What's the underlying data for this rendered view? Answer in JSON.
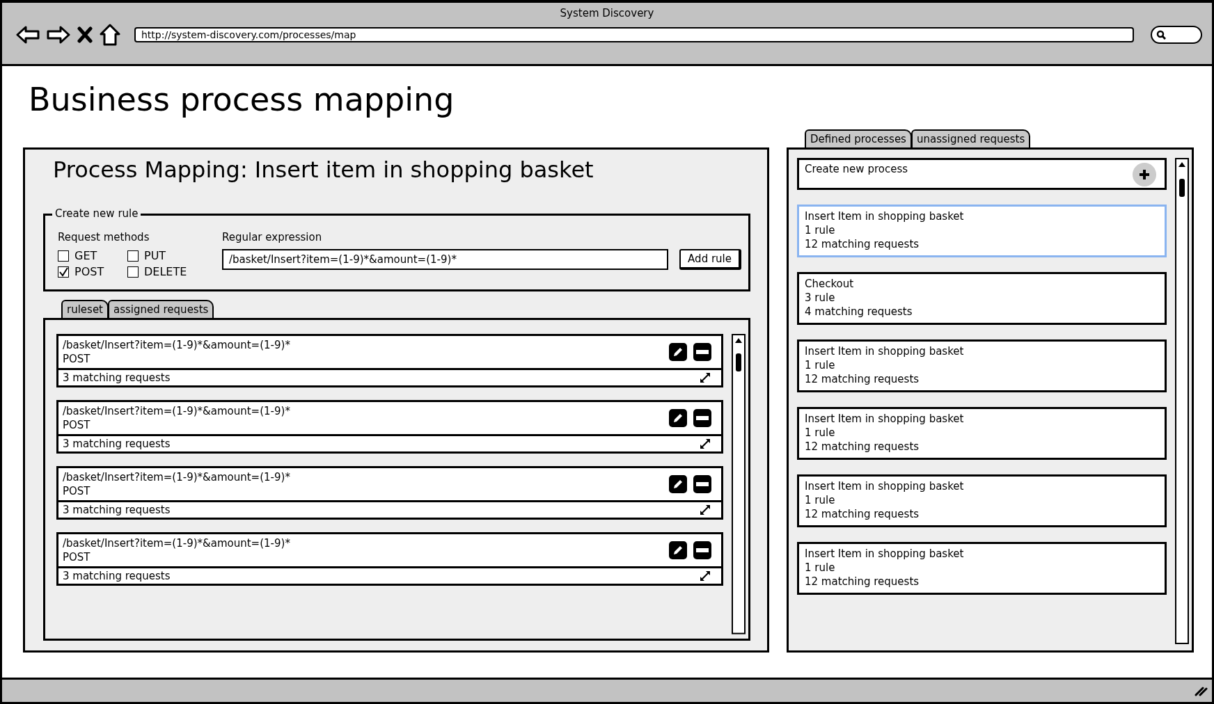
{
  "browser": {
    "title": "System Discovery",
    "url": "http://system-discovery.com/processes/map"
  },
  "page_title": "Business process mapping",
  "mapping": {
    "title": "Process Mapping: Insert item in shopping basket",
    "create_rule": {
      "legend": "Create new rule",
      "methods_label": "Request methods",
      "methods": [
        {
          "label": "GET",
          "checked": false
        },
        {
          "label": "PUT",
          "checked": false
        },
        {
          "label": "POST",
          "checked": true
        },
        {
          "label": "DELETE",
          "checked": false
        }
      ],
      "regex_label": "Regular expression",
      "regex_value": "/basket/Insert?item=(1-9)*&amount=(1-9)*",
      "add_button": "Add rule"
    },
    "tabs": [
      {
        "label": "ruleset"
      },
      {
        "label": "assigned requests"
      }
    ],
    "rules": [
      {
        "pattern": "/basket/Insert?item=(1-9)*&amount=(1-9)*",
        "method": "POST",
        "matches": "3 matching requests"
      },
      {
        "pattern": "/basket/Insert?item=(1-9)*&amount=(1-9)*",
        "method": "POST",
        "matches": "3 matching requests"
      },
      {
        "pattern": "/basket/Insert?item=(1-9)*&amount=(1-9)*",
        "method": "POST",
        "matches": "3 matching requests"
      },
      {
        "pattern": "/basket/Insert?item=(1-9)*&amount=(1-9)*",
        "method": "POST",
        "matches": "3 matching requests"
      }
    ]
  },
  "processes": {
    "tabs": [
      {
        "label": "Defined processes"
      },
      {
        "label": "unassigned requests"
      }
    ],
    "create": "Create new process",
    "items": [
      {
        "name": "Insert Item in shopping basket",
        "rules": "1 rule",
        "matches": "12 matching requests",
        "selected": true
      },
      {
        "name": "Checkout",
        "rules": "3 rule",
        "matches": "4 matching requests",
        "selected": false
      },
      {
        "name": "Insert Item in shopping basket",
        "rules": "1 rule",
        "matches": "12 matching requests",
        "selected": false
      },
      {
        "name": "Insert Item in shopping basket",
        "rules": "1 rule",
        "matches": "12 matching requests",
        "selected": false
      },
      {
        "name": "Insert Item in shopping basket",
        "rules": "1 rule",
        "matches": "12 matching requests",
        "selected": false
      },
      {
        "name": "Insert Item in shopping basket",
        "rules": "1 rule",
        "matches": "12 matching requests",
        "selected": false
      }
    ]
  }
}
